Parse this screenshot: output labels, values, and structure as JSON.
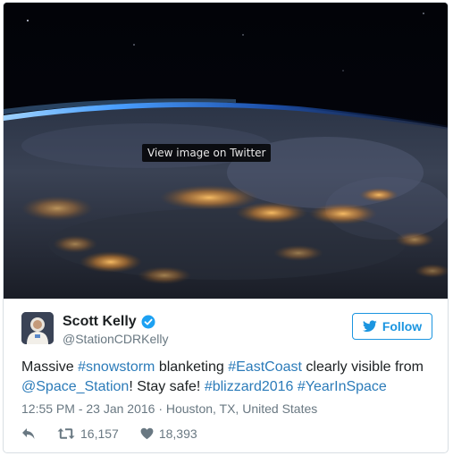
{
  "media": {
    "tooltip": "View image on Twitter"
  },
  "author": {
    "name": "Scott Kelly",
    "handle": "@StationCDRKelly",
    "verified": true
  },
  "follow_button": {
    "label": "Follow"
  },
  "tweet": {
    "parts": [
      {
        "text": "Massive ",
        "type": "plain"
      },
      {
        "text": "#snowstorm",
        "type": "link"
      },
      {
        "text": " blanketing ",
        "type": "plain"
      },
      {
        "text": "#EastCoast",
        "type": "link"
      },
      {
        "text": " clearly visible from ",
        "type": "plain"
      },
      {
        "text": "@Space_Station",
        "type": "link"
      },
      {
        "text": "! Stay safe! ",
        "type": "plain"
      },
      {
        "text": "#blizzard2016",
        "type": "link"
      },
      {
        "text": " ",
        "type": "plain"
      },
      {
        "text": "#YearInSpace",
        "type": "link"
      }
    ]
  },
  "meta": {
    "timestamp": "12:55 PM - 23 Jan 2016 · Houston, TX, United States"
  },
  "actions": {
    "retweets": "16,157",
    "likes": "18,393"
  },
  "icons": {
    "reply": "reply-icon",
    "retweet": "retweet-icon",
    "like": "heart-icon",
    "bird": "twitter-bird-icon",
    "verified": "verified-badge-icon"
  },
  "colors": {
    "link": "#2b7bb9",
    "accent": "#1b95e0",
    "text": "#1c2022",
    "muted": "#697882"
  }
}
